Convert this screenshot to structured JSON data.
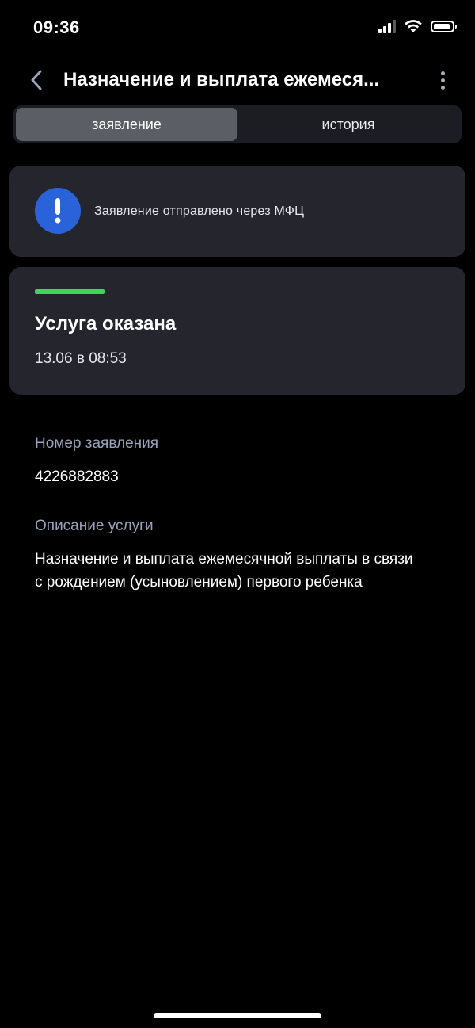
{
  "status_bar": {
    "time": "09:36"
  },
  "header": {
    "title": "Назначение и выплата ежемеся...",
    "back_icon": "chevron-left-icon",
    "more_icon": "more-vertical-icon"
  },
  "tabs": [
    {
      "label": "заявление",
      "active": true
    },
    {
      "label": "история",
      "active": false
    }
  ],
  "notice": {
    "icon": "exclamation-icon",
    "text": "Заявление отправлено через МФЦ",
    "icon_color": "#2a63d9"
  },
  "status": {
    "title": "Услуга оказана",
    "date": "13.06 в 08:53",
    "indicator_color": "#3fd657"
  },
  "details": {
    "number_label": "Номер заявления",
    "number_value": "4226882883",
    "description_label": "Описание услуги",
    "description_value": "Назначение и выплата ежемесячной выплаты в связи с рождением (усыновлением) первого ребенка"
  },
  "colors": {
    "background": "#000000",
    "card": "#25262d",
    "label": "#9aa3bd"
  }
}
